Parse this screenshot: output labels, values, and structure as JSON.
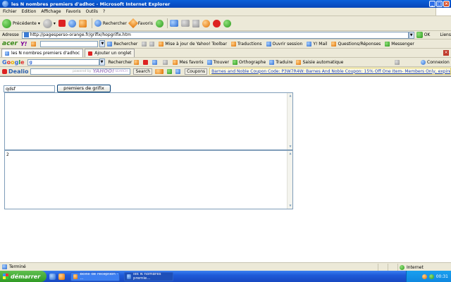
{
  "window": {
    "title": "les N nombres premiers d'adhoc - Microsoft Internet Explorer"
  },
  "colors": {
    "titlebar": "#0a5fd9",
    "taskbar": "#1f5ad8",
    "start": "#2f9a24"
  },
  "menu": {
    "items": [
      "Fichier",
      "Edition",
      "Affichage",
      "Favoris",
      "Outils",
      "?"
    ]
  },
  "toolbar": {
    "back": "Précédente",
    "search": "Rechercher",
    "favorites": "Favoris"
  },
  "address": {
    "label": "Adresse",
    "url": "http://pagesperso-orange.fr/grifix/hopgrifix.htm",
    "go": "OK",
    "links": "Liens"
  },
  "yahoo_bar": {
    "acer": "acer",
    "yahoo": "Y!",
    "search_btn": "Rechercher",
    "update": "Mise à jour de Yahoo! Toolbar",
    "translations": "Traductions",
    "open_session": "Ouvrir session",
    "mail": "Y! Mail",
    "qa": "Questions/Réponses",
    "messenger": "Messenger"
  },
  "tabs": {
    "active": "les N nombres premiers d'adhoc",
    "new": "Ajouter un onglet"
  },
  "google_bar": {
    "logo": [
      "G",
      "o",
      "o",
      "g",
      "l",
      "e"
    ],
    "input_value": "g",
    "search": "Rechercher",
    "favorites": "Mes favoris",
    "find": "Trouver",
    "spelling": "Orthographe",
    "translate": "Traduire",
    "autofill": "Saisie automatique",
    "connect": "Connexion"
  },
  "dealio_bar": {
    "logo": "Dealio",
    "powered": "powered by",
    "yahoo_search": "YAHOO!",
    "search_word": "SEARCH",
    "search_btn": "Search",
    "coupons": "Coupons",
    "ticker": "Barnes and Noble Coupon Code: P3W7R4W: Barnes And Noble Coupon: 15% Off One Item- Members Only, expires Apri"
  },
  "form": {
    "input_value": "qdsf",
    "button_label": "premiers de grifix",
    "output1": "",
    "output2": "2"
  },
  "status": {
    "text": "Terminé",
    "zone": "Internet"
  },
  "taskbar": {
    "start": "démarrer",
    "task1": "Boîte de réception - ...",
    "task2": "les N nombres premie...",
    "clock": "00:31"
  }
}
